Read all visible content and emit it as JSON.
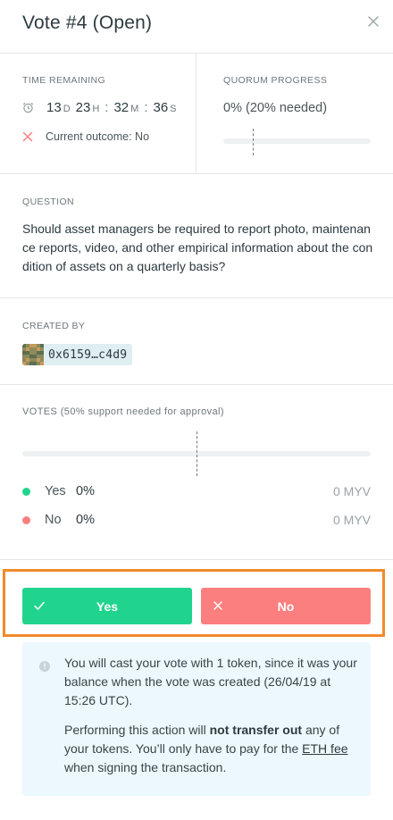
{
  "panel": {
    "title": "Vote #4 (Open)",
    "close_icon": "close-icon"
  },
  "time_remaining": {
    "label": "TIME REMAINING",
    "days": "13",
    "days_unit": "D",
    "hours": "23",
    "hours_unit": "H",
    "minutes": "32",
    "minutes_unit": "M",
    "seconds": "36",
    "seconds_unit": "S",
    "sep": ":",
    "outcome": "Current outcome: No"
  },
  "quorum": {
    "label": "QUORUM PROGRESS",
    "text": "0% (20% needed)",
    "progress": 0,
    "needed": 0.2
  },
  "question": {
    "label": "QUESTION",
    "text": "Should asset managers be required to report photo, maintenance reports, video, and other empirical information about the condition of assets on a quarterly basis?"
  },
  "created_by": {
    "label": "CREATED BY",
    "address": "0x6159…c4d9"
  },
  "votes": {
    "label": "VOTES (50% support needed for approval)",
    "support_needed": 0.5,
    "yes": {
      "name": "Yes",
      "pct": "0%",
      "amount": "0 MYV"
    },
    "no": {
      "name": "No",
      "pct": "0%",
      "amount": "0 MYV"
    }
  },
  "actions": {
    "yes_label": "Yes",
    "no_label": "No"
  },
  "info": {
    "p1": "You will cast your vote with 1 token, since it was your balance when the vote was created (26/04/19 at 15:26 UTC).",
    "p2_a": "Performing this action will ",
    "p2_bold": "not transfer out",
    "p2_b": " any of your tokens. You’ll only have to pay for the ",
    "p2_link": "ETH fee",
    "p2_c": " when signing the transaction."
  },
  "colors": {
    "yes": "#21d48e",
    "no": "#fb7f7f",
    "highlight": "#f28a2a",
    "info_bg": "#ecf8fd"
  }
}
